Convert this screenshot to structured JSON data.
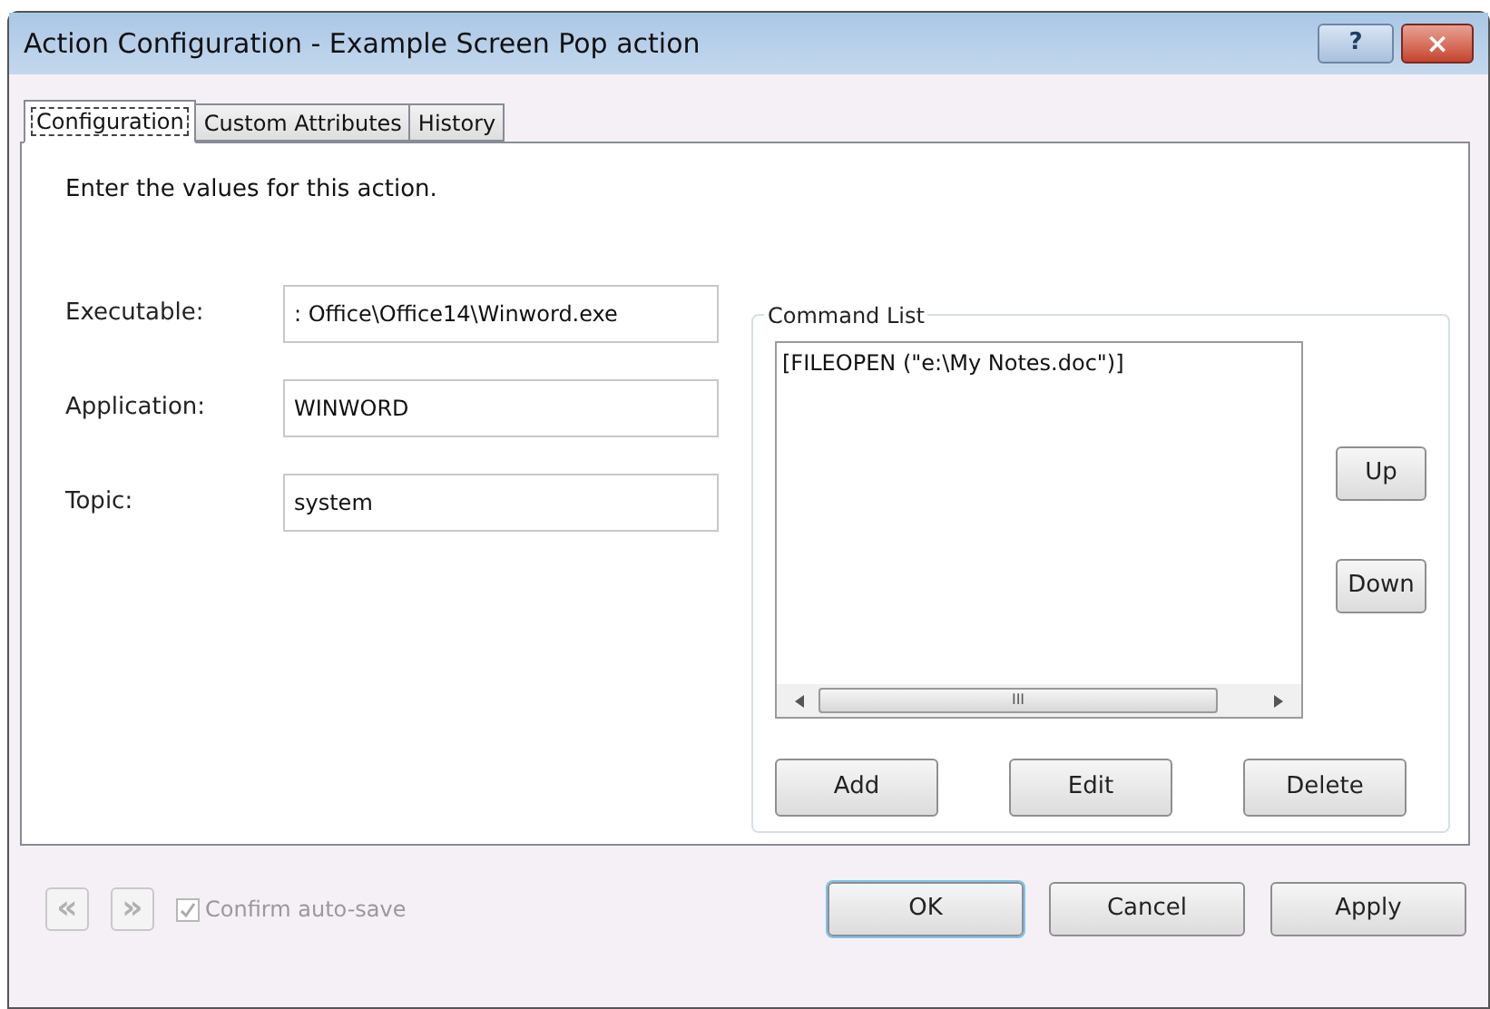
{
  "window": {
    "title": "Action Configuration - Example Screen Pop action",
    "help_button": "?",
    "close_button": "×"
  },
  "tabs": [
    {
      "label": "Configuration",
      "selected": true
    },
    {
      "label": "Custom Attributes",
      "selected": false
    },
    {
      "label": "History",
      "selected": false
    }
  ],
  "instructions": "Enter the values for this action.",
  "fields": [
    {
      "label": "Executable:",
      "value": ": Office\\Office14\\Winword.exe"
    },
    {
      "label": "Application:",
      "value": "WINWORD"
    },
    {
      "label": "Topic:",
      "value": "system"
    }
  ],
  "command_list": {
    "title": "Command List",
    "items": [
      "[FILEOPEN (\"e:\\My Notes.doc\")]"
    ],
    "scroll_grip": "III",
    "side_buttons": [
      "Up",
      "Down"
    ],
    "bottom_buttons": [
      "Add",
      "Edit",
      "Delete"
    ]
  },
  "footer": {
    "nav_buttons": [
      {
        "label": "«",
        "disabled": true
      },
      {
        "label": "»",
        "disabled": true
      }
    ],
    "checkbox": {
      "label": "Confirm auto-save",
      "checked": true,
      "disabled": true
    },
    "buttons": [
      {
        "label": "OK",
        "default": true
      },
      {
        "label": "Cancel",
        "default": false
      },
      {
        "label": "Apply",
        "default": false
      }
    ]
  }
}
